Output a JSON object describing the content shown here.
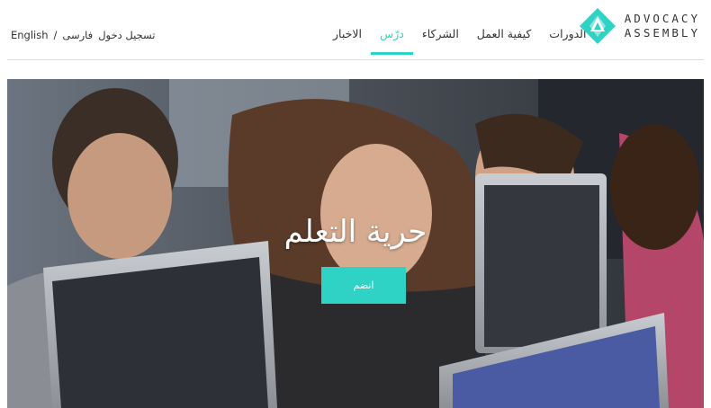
{
  "brand": {
    "line1": "ADVOCACY",
    "line2": "ASSEMBLY",
    "accent": "#2ed3c6"
  },
  "nav": {
    "items": [
      {
        "label": "الدورات",
        "name": "nav-courses",
        "active": false
      },
      {
        "label": "كيفية العمل",
        "name": "nav-how-it-works",
        "active": false
      },
      {
        "label": "الشركاء",
        "name": "nav-partners",
        "active": false
      },
      {
        "label": "درّس",
        "name": "nav-teach",
        "active": true
      },
      {
        "label": "الاخبار",
        "name": "nav-news",
        "active": false
      }
    ]
  },
  "topbar": {
    "english": "English",
    "separator": "/",
    "farsi": "فارسی",
    "login": "تسجيل دخول"
  },
  "hero": {
    "title": "حرية التعلم",
    "join_label": "انضم"
  }
}
